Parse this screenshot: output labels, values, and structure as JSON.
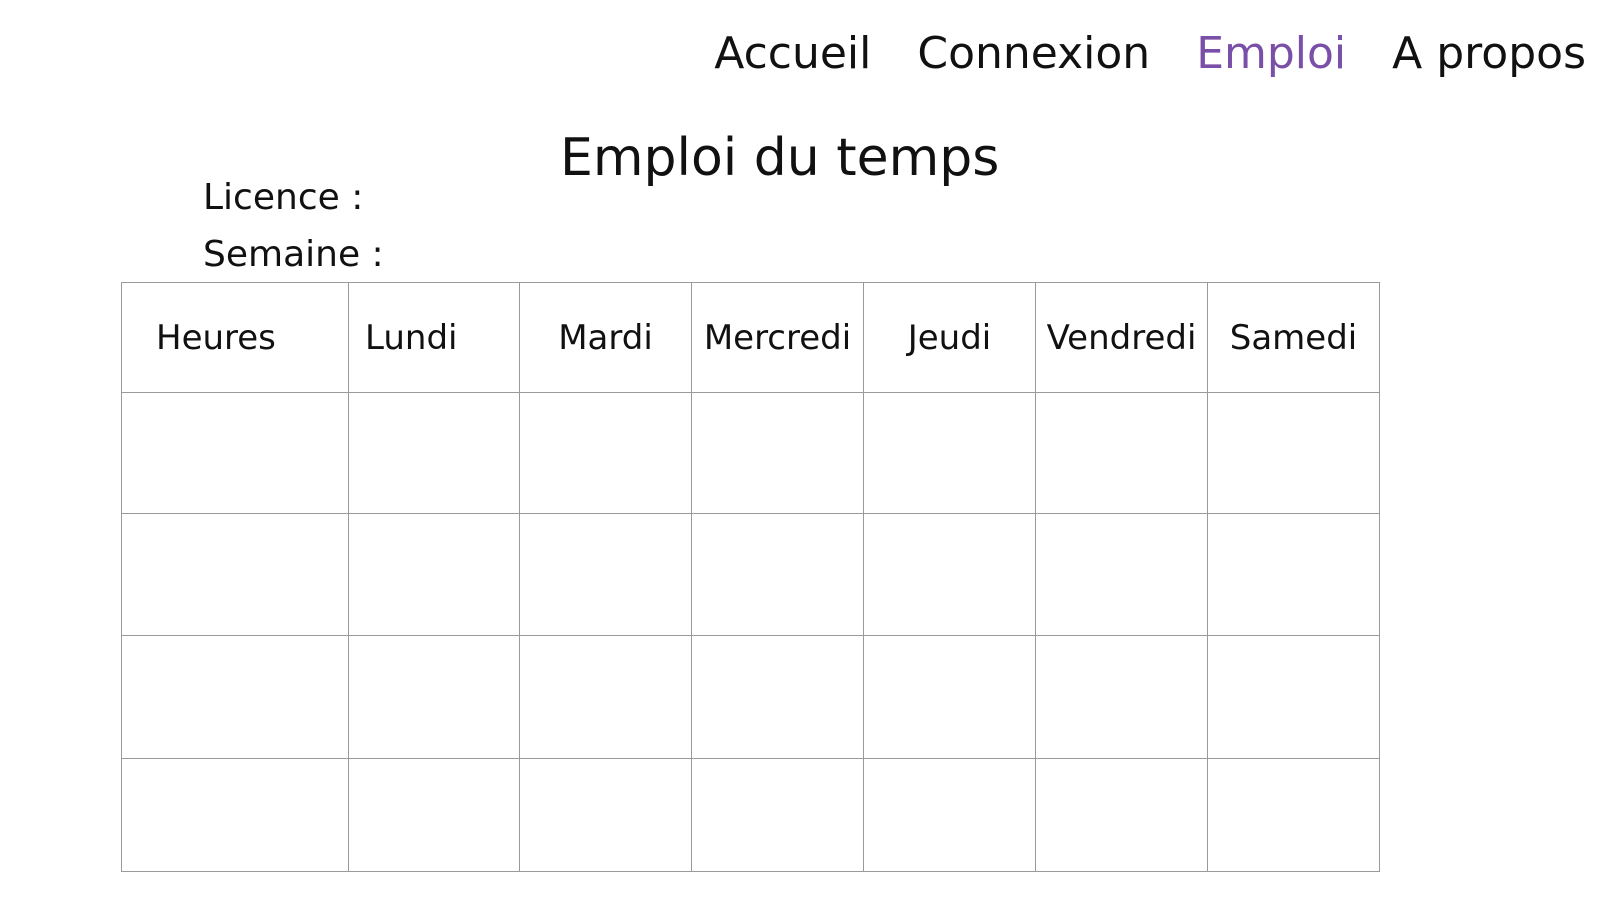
{
  "nav": {
    "items": [
      {
        "label": "Accueil",
        "active": false
      },
      {
        "label": "Connexion",
        "active": false
      },
      {
        "label": "Emploi",
        "active": true
      },
      {
        "label": "A propos",
        "active": false
      }
    ],
    "active_color": "#7a4fa7"
  },
  "page": {
    "title": "Emploi du temps",
    "licence_label": "Licence :",
    "semaine_label": "Semaine :"
  },
  "timetable": {
    "columns": [
      "Heures",
      "Lundi",
      "Mardi",
      "Mercredi",
      "Jeudi",
      "Vendredi",
      "Samedi"
    ],
    "rows": [
      [
        "",
        "",
        "",
        "",
        "",
        "",
        ""
      ],
      [
        "",
        "",
        "",
        "",
        "",
        "",
        ""
      ],
      [
        "",
        "",
        "",
        "",
        "",
        "",
        ""
      ],
      [
        "",
        "",
        "",
        "",
        "",
        "",
        ""
      ]
    ]
  }
}
